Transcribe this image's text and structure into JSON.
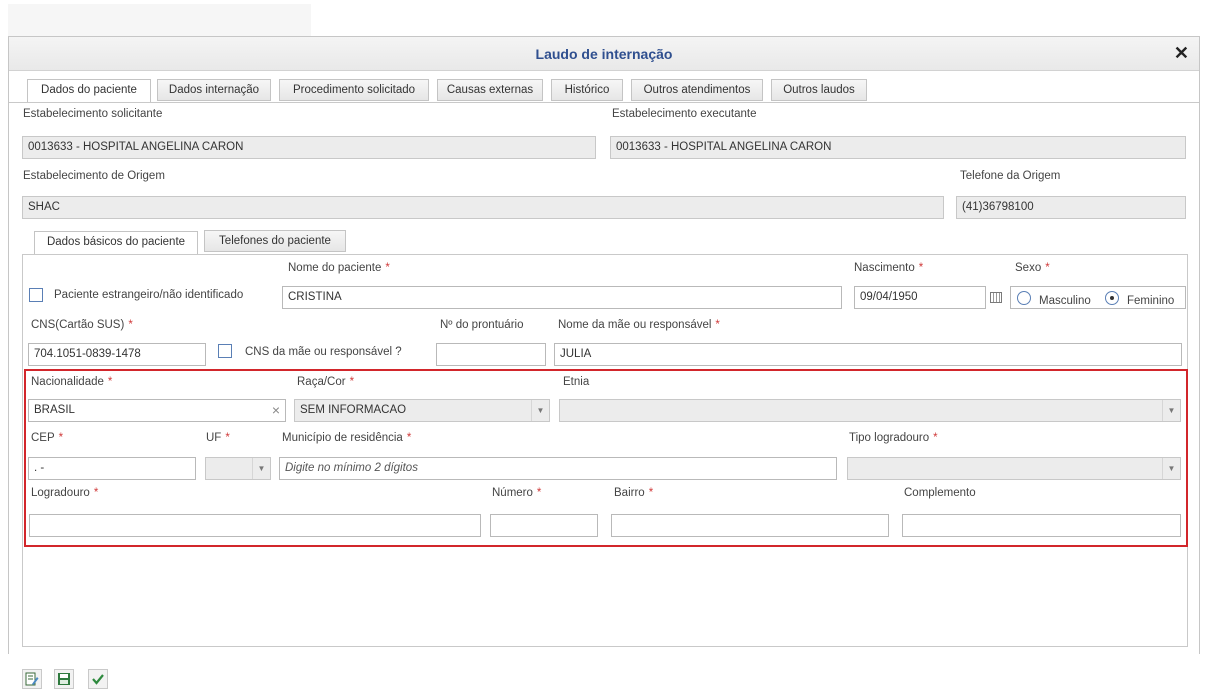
{
  "window": {
    "title": "Laudo de internação"
  },
  "tabs": [
    "Dados do paciente",
    "Dados internação",
    "Procedimento solicitado",
    "Causas externas",
    "Histórico",
    "Outros atendimentos",
    "Outros laudos"
  ],
  "establishment": {
    "solicitante_label": "Estabelecimento solicitante",
    "solicitante_value": "0013633 - HOSPITAL ANGELINA CARON",
    "executante_label": "Estabelecimento executante",
    "executante_value": "0013633 - HOSPITAL ANGELINA CARON",
    "origem_label": "Estabelecimento de Origem",
    "origem_value": "SHAC",
    "telefone_label": "Telefone da Origem",
    "telefone_value": "(41)36798100"
  },
  "subtabs": [
    "Dados básicos do paciente",
    "Telefones do paciente"
  ],
  "patient": {
    "nome_label": "Nome do paciente",
    "nome_value": "CRISTINA",
    "nascimento_label": "Nascimento",
    "nascimento_value": "09/04/1950",
    "sexo_label": "Sexo",
    "sexo_masculino": "Masculino",
    "sexo_feminino": "Feminino",
    "sexo_selected": "Feminino",
    "estrangeiro_label": "Paciente estrangeiro/não identificado",
    "cns_label": "CNS(Cartão SUS)",
    "cns_value": "704.1051-0839-1478",
    "cns_mae_label": "CNS da mãe ou responsável ?",
    "prontuario_label": "Nº do prontuário",
    "prontuario_value": "",
    "mae_label": "Nome da mãe ou responsável",
    "mae_value": "JULIA"
  },
  "address": {
    "nacionalidade_label": "Nacionalidade",
    "nacionalidade_value": "BRASIL",
    "raca_label": "Raça/Cor",
    "raca_value": "SEM INFORMACAO",
    "etnia_label": "Etnia",
    "etnia_value": "",
    "cep_label": "CEP",
    "cep_value": ". -",
    "uf_label": "UF",
    "uf_value": "",
    "municipio_label": "Município de residência",
    "municipio_placeholder": "Digite no mínimo 2 dígitos",
    "tipo_logradouro_label": "Tipo logradouro",
    "logradouro_label": "Logradouro",
    "numero_label": "Número",
    "bairro_label": "Bairro",
    "complemento_label": "Complemento"
  },
  "required_marker": "*",
  "icons": {
    "close": "close-icon",
    "calendar": "calendar-icon",
    "edit": "edit-icon",
    "save": "save-icon",
    "confirm": "check-icon"
  },
  "colors": {
    "title": "#2f4f8f",
    "required": "#d03a3a",
    "highlight": "#d2262b"
  }
}
